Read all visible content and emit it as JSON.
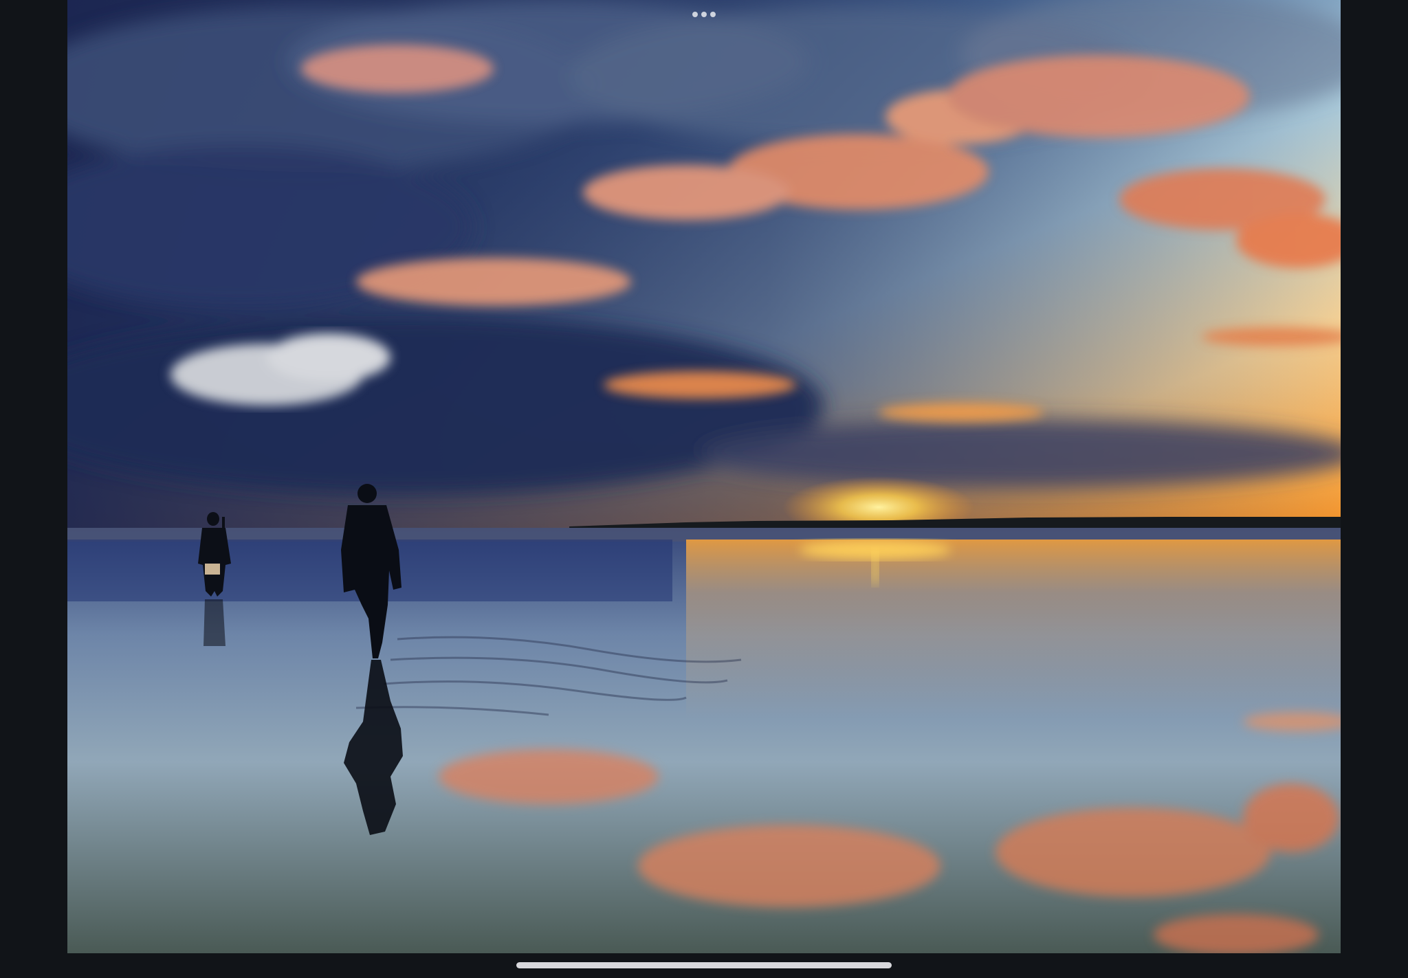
{
  "screen": {
    "background": "#111418"
  },
  "multitasking": {
    "icon": "more-dots-icon"
  },
  "photo": {
    "colors": {
      "sky_top": "#34507e",
      "sky_mid": "#8fb5cf",
      "horizon_glow": "#f4a640",
      "sun": "#ffd65a",
      "cloud_dark": "#26345c",
      "cloud_pink": "#e58c68",
      "water": "#3a4b6b",
      "silhouette": "#0c0f17"
    }
  },
  "home_indicator": {
    "color": "#d8d8dc"
  }
}
